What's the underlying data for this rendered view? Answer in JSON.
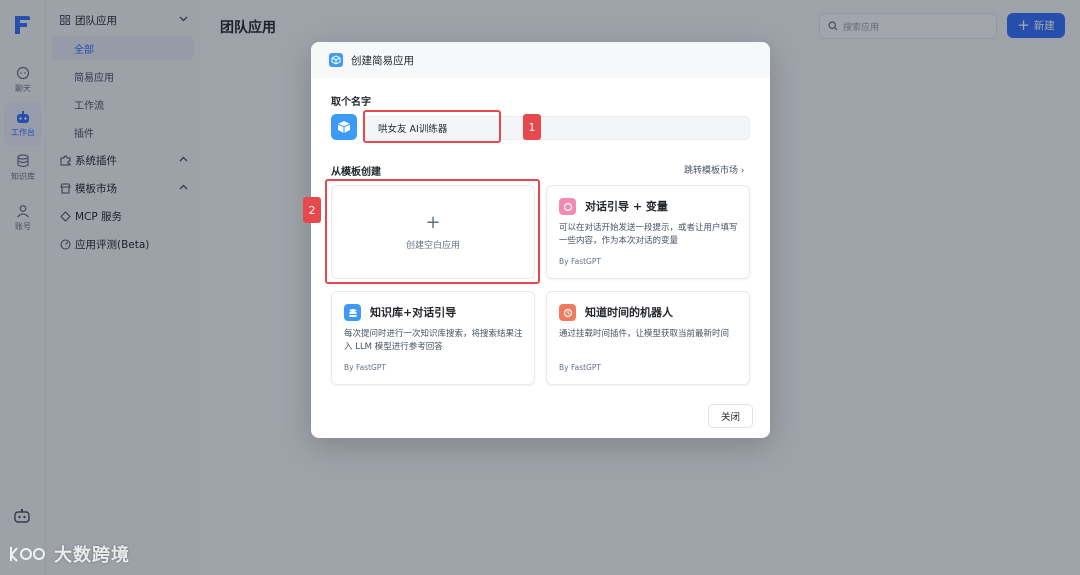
{
  "nav": {
    "items": [
      {
        "label": "聊天",
        "icon": "chat-icon"
      },
      {
        "label": "工作台",
        "icon": "robot-icon",
        "active": true
      },
      {
        "label": "知识库",
        "icon": "database-icon"
      },
      {
        "label": "账号",
        "icon": "user-icon"
      }
    ]
  },
  "sidebar": {
    "team_apps": "团队应用",
    "sub_items": [
      "全部",
      "简易应用",
      "工作流",
      "插件"
    ],
    "system_plugins": "系统插件",
    "template_market": "模板市场",
    "mcp": "MCP 服务",
    "eval": "应用评测(Beta)"
  },
  "header": {
    "title": "团队应用",
    "search_placeholder": "搜索应用",
    "new_label": "新建"
  },
  "modal": {
    "title": "创建简易应用",
    "name_label": "取个名字",
    "name_value": "哄女友 AI训练器",
    "from_template_label": "从模板创建",
    "template_link": "跳转模板市场 ›",
    "blank_label": "创建空白应用",
    "close_label": "关闭",
    "cards": [
      {
        "title": "对话引导 + 变量",
        "desc": "可以在对话开始发送一段提示，或者让用户填写一些内容，作为本次对话的变量",
        "by": "By FastGPT"
      },
      {
        "title": "知识库+对话引导",
        "desc": "每次提问时进行一次知识库搜索，将搜索结果注入 LLM 模型进行参考回答",
        "by": "By FastGPT"
      },
      {
        "title": "知道时间的机器人",
        "desc": "通过挂载时间插件，让模型获取当前最新时间",
        "by": "By FastGPT"
      }
    ]
  },
  "annotations": {
    "badge1": "1",
    "badge2": "2"
  },
  "watermark": "大数跨境",
  "colors": {
    "accent": "#3370ff",
    "annotation": "#e5484d"
  }
}
